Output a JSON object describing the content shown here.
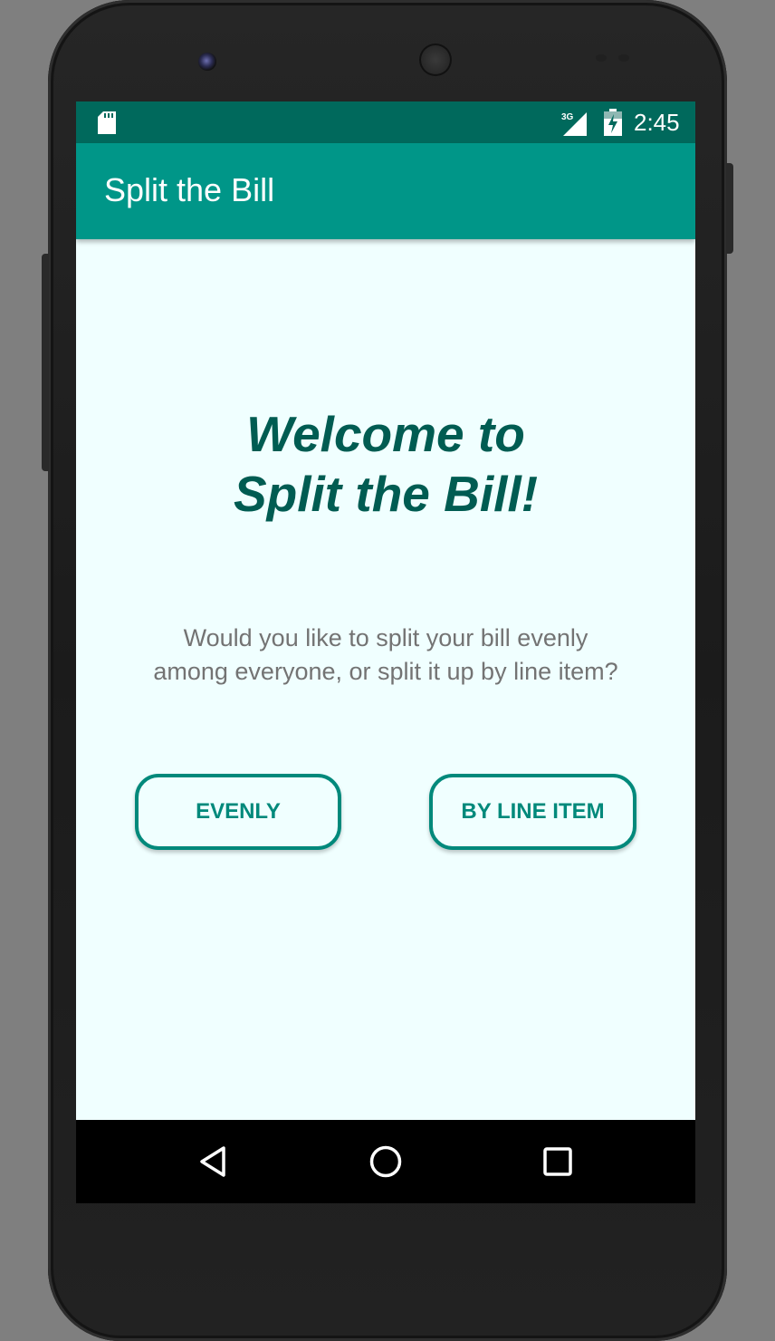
{
  "status_bar": {
    "time": "2:45",
    "network_label": "3G",
    "icons": [
      "sd-card-icon",
      "signal-icon",
      "battery-icon"
    ]
  },
  "app_bar": {
    "title": "Split the Bill"
  },
  "main": {
    "welcome_line1": "Welcome to",
    "welcome_line2": "Split the Bill!",
    "prompt_line1": "Would you like to split your bill evenly",
    "prompt_line2": "among everyone, or split it up by line item?",
    "buttons": {
      "evenly": "EVENLY",
      "by_line_item": "BY LINE ITEM"
    }
  },
  "nav_bar": {
    "icons": [
      "back-icon",
      "home-icon",
      "recent-apps-icon"
    ]
  },
  "colors": {
    "status_bar": "#00695c",
    "app_bar": "#009688",
    "screen_background": "#f0ffff",
    "welcome_text": "#005c52",
    "button_accent": "#00897b",
    "prompt_text": "#737373"
  }
}
